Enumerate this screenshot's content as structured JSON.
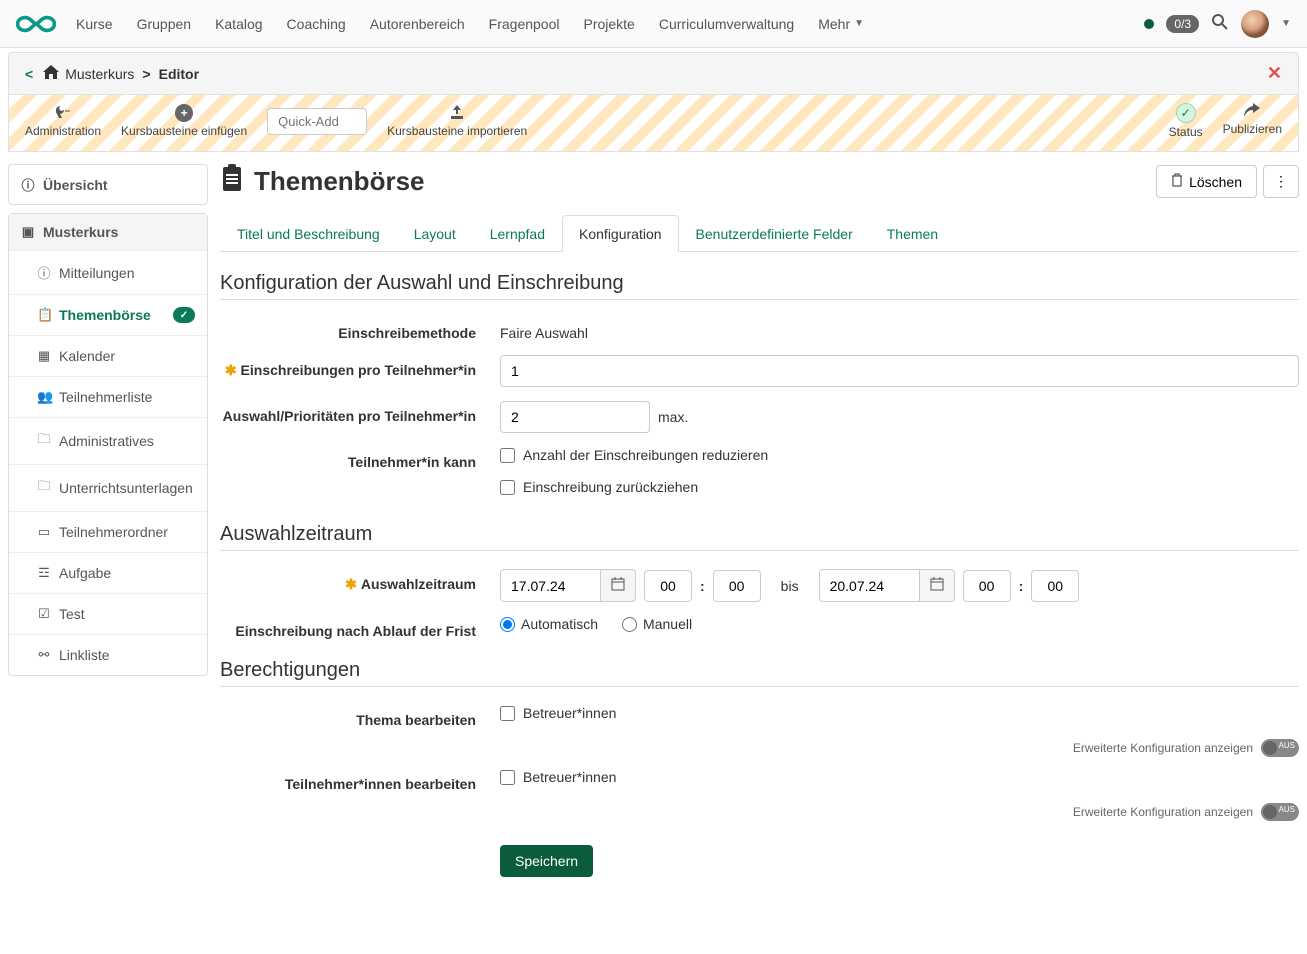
{
  "nav": {
    "items": [
      "Kurse",
      "Gruppen",
      "Katalog",
      "Coaching",
      "Autorenbereich",
      "Fragenpool",
      "Projekte",
      "Curriculumverwaltung"
    ],
    "more": "Mehr",
    "badge": "0/3"
  },
  "breadcrumb": {
    "course": "Musterkurs",
    "current": "Editor"
  },
  "toolbar": {
    "admin": "Administration",
    "insert": "Kursbausteine einfügen",
    "quickadd_placeholder": "Quick-Add",
    "import": "Kursbausteine importieren",
    "status": "Status",
    "publish": "Publizieren"
  },
  "sidebar": {
    "overview": "Übersicht",
    "course": "Musterkurs",
    "items": [
      {
        "icon": "ℹ",
        "label": "Mitteilungen"
      },
      {
        "icon": "📋",
        "label": "Themenbörse",
        "active": true,
        "badge": true
      },
      {
        "icon": "📅",
        "label": "Kalender"
      },
      {
        "icon": "👥",
        "label": "Teilnehmerliste"
      },
      {
        "icon": "📁",
        "label": "Administratives"
      },
      {
        "icon": "📁",
        "label": "Unterrichtsunterlagen"
      },
      {
        "icon": "💻",
        "label": "Teilnehmerordner"
      },
      {
        "icon": "☰",
        "label": "Aufgabe"
      },
      {
        "icon": "✓",
        "label": "Test"
      },
      {
        "icon": "🔗",
        "label": "Linkliste"
      }
    ]
  },
  "page": {
    "title": "Themenbörse",
    "delete": "Löschen"
  },
  "tabs": [
    "Titel und Beschreibung",
    "Layout",
    "Lernpfad",
    "Konfiguration",
    "Benutzerdefinierte Felder",
    "Themen"
  ],
  "active_tab": 3,
  "form": {
    "section1_title": "Konfiguration der Auswahl und Einschreibung",
    "method_label": "Einschreibemethode",
    "method_value": "Faire Auswahl",
    "enrollments_label": "Einschreibungen pro Teilnehmer*in",
    "enrollments_value": "1",
    "priorities_label": "Auswahl/Prioritäten pro Teilnehmer*in",
    "priorities_value": "2",
    "priorities_suffix": "max.",
    "participant_can_label": "Teilnehmer*in kann",
    "reduce_label": "Anzahl der Einschreibungen reduzieren",
    "withdraw_label": "Einschreibung zurückziehen",
    "section2_title": "Auswahlzeitraum",
    "period_label": "Auswahlzeitraum",
    "date_from": "17.07.24",
    "hour_from": "00",
    "min_from": "00",
    "between": "bis",
    "date_to": "20.07.24",
    "hour_to": "00",
    "min_to": "00",
    "after_deadline_label": "Einschreibung nach Ablauf der Frist",
    "auto_label": "Automatisch",
    "manual_label": "Manuell",
    "section3_title": "Berechtigungen",
    "edit_topic_label": "Thema bearbeiten",
    "supervisors_label": "Betreuer*innen",
    "edit_participants_label": "Teilnehmer*innen bearbeiten",
    "advanced_label": "Erweiterte Konfiguration anzeigen",
    "toggle_off": "AUS",
    "save": "Speichern"
  }
}
